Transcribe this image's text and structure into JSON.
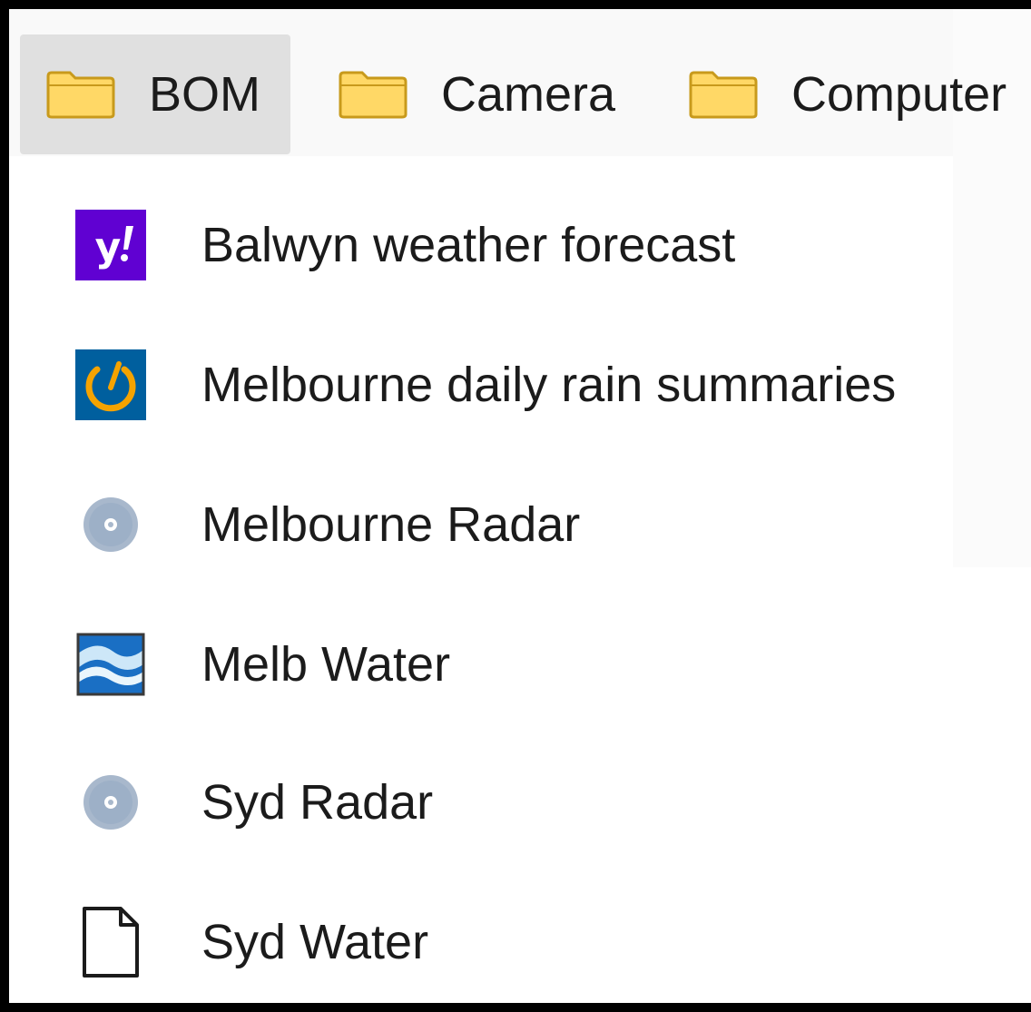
{
  "bookmarks_bar": {
    "folders": [
      {
        "label": "BOM",
        "icon": "folder-icon",
        "active": true
      },
      {
        "label": "Camera",
        "icon": "folder-icon",
        "active": false
      },
      {
        "label": "Computer",
        "icon": "folder-icon",
        "active": false
      }
    ]
  },
  "menu": {
    "items": [
      {
        "label": "Balwyn weather forecast",
        "icon": "yahoo-icon"
      },
      {
        "label": "Melbourne daily rain summaries",
        "icon": "gauge-icon"
      },
      {
        "label": "Melbourne Radar",
        "icon": "radar-icon"
      },
      {
        "label": "Melb Water",
        "icon": "water-icon"
      },
      {
        "label": "Syd Radar",
        "icon": "radar-icon"
      },
      {
        "label": "Syd Water",
        "icon": "blank-page-icon"
      }
    ]
  },
  "colors": {
    "folder_fill": "#ffd866",
    "folder_stroke": "#c89a1c",
    "yahoo_purple": "#6001d2",
    "gauge_blue": "#005f9e",
    "gauge_orange": "#f5a300",
    "radar_grey": "#a8b8cc",
    "water_blue": "#1a6fc4"
  }
}
